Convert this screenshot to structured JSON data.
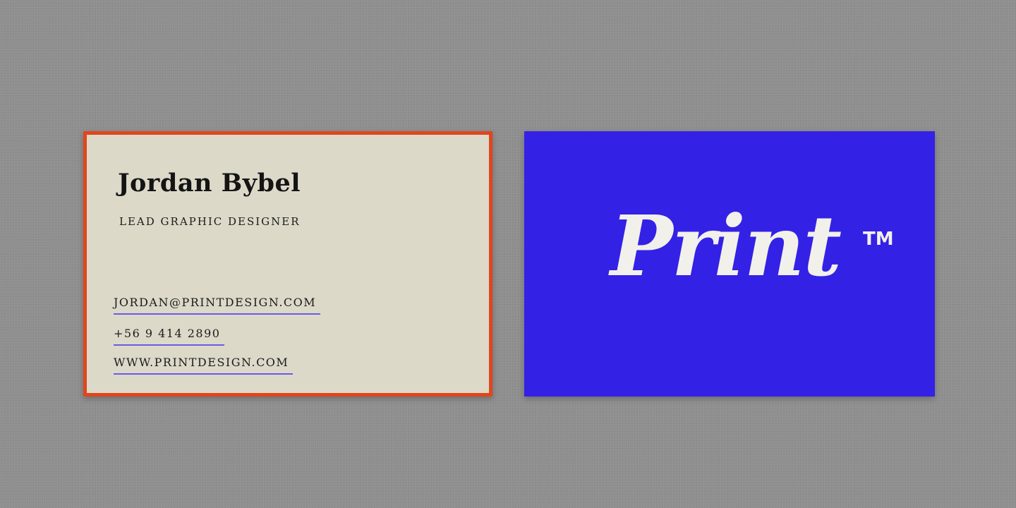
{
  "front_card": {
    "name": "Jordan Bybel",
    "title": "LEAD GRAPHIC DESIGNER",
    "email": "JORDAN@PRINTDESIGN.COM",
    "phone": "+56 9 414 2890",
    "website": "WWW.PRINTDESIGN.COM"
  },
  "back_card": {
    "logo_text": "Print",
    "trademark": "TM"
  },
  "colors": {
    "background": "#8f8f8f",
    "front_card_paper": "#dcd9c9",
    "front_card_border": "#e0461c",
    "link_underline": "#6a5be6",
    "back_card": "#3321e6",
    "logo_text": "#f2f0ea"
  }
}
